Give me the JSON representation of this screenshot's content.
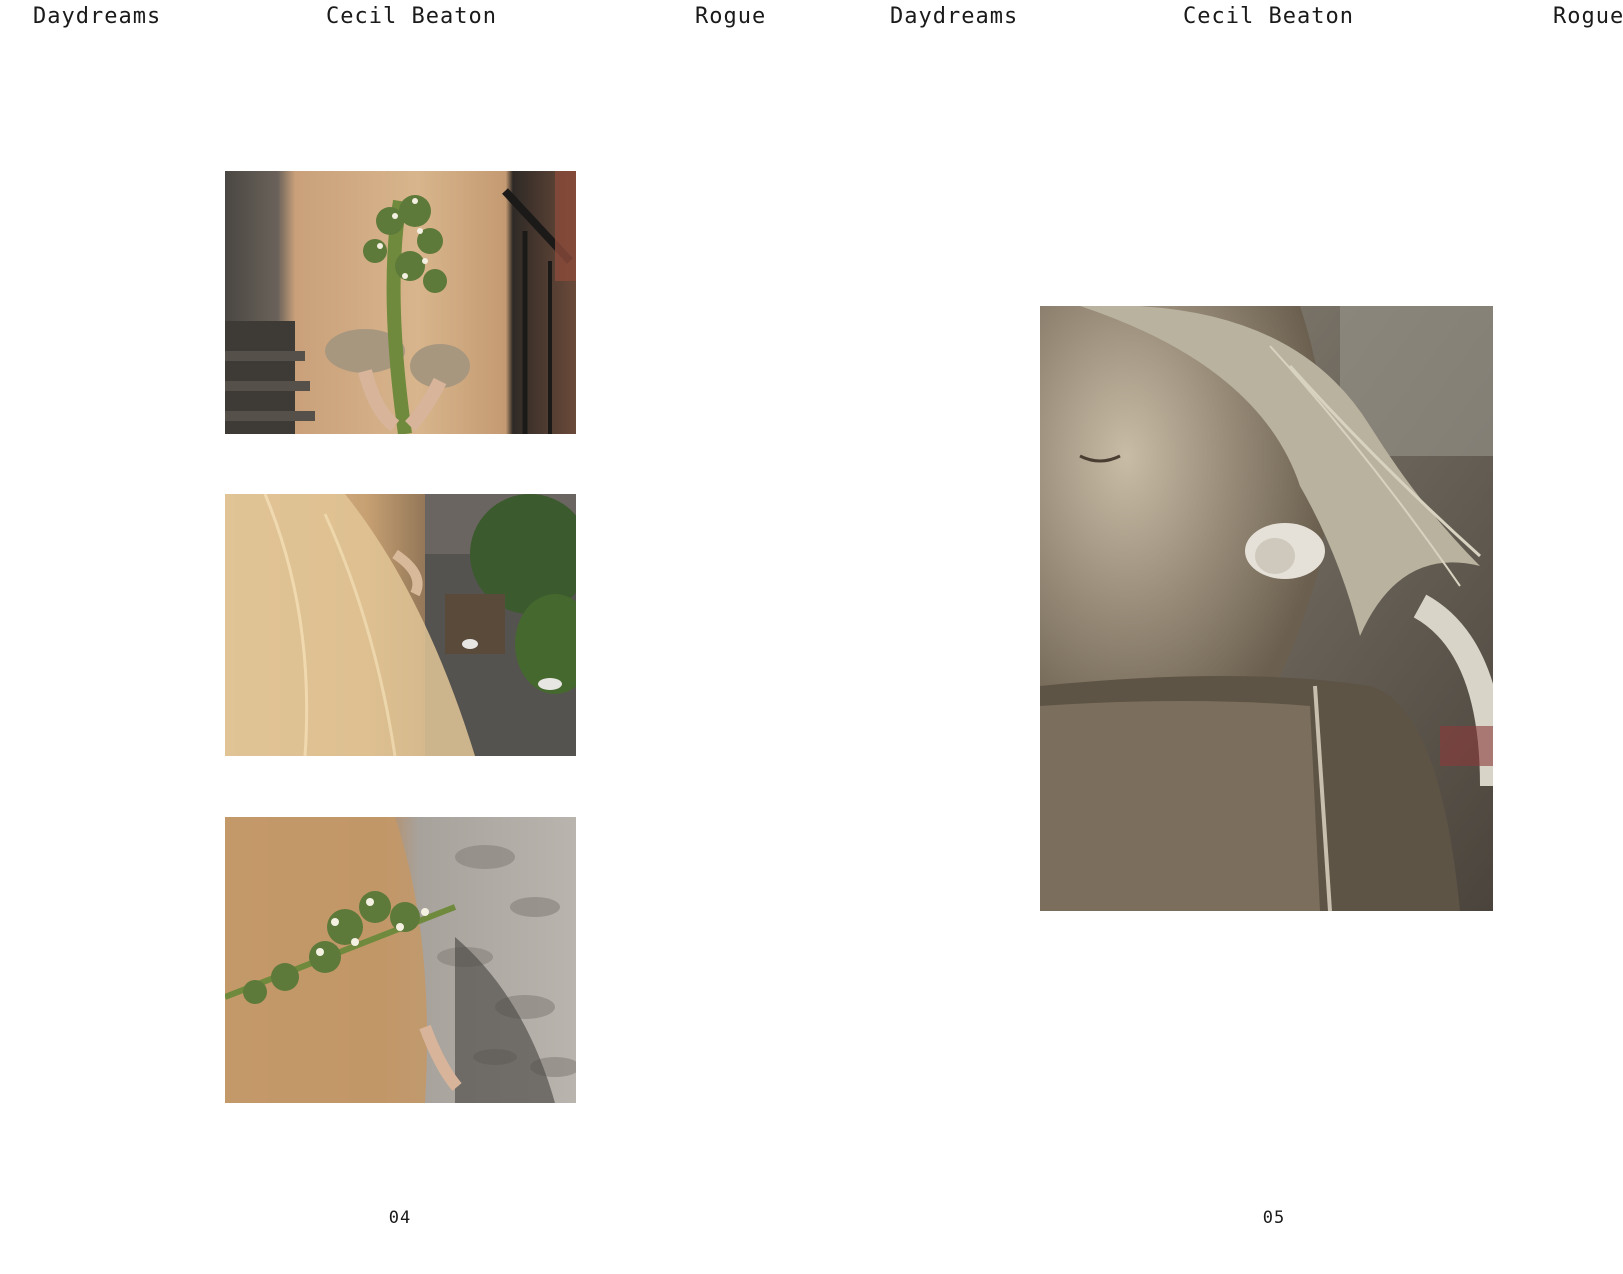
{
  "header": {
    "words": [
      "Daydreams",
      "Cecil Beaton",
      "Rogue",
      "Daydreams",
      "Cecil Beaton",
      "Rogue"
    ]
  },
  "spreads": [
    {
      "page_number": "04",
      "images": [
        {
          "subject": "hands-holding-daisy-bouquet-behind-back"
        },
        {
          "subject": "sheer-dress-in-garden-courtyard"
        },
        {
          "subject": "daisy-bouquet-against-stucco-wall"
        }
      ]
    },
    {
      "page_number": "05",
      "images": [
        {
          "subject": "portrait-woman-with-flower-earring"
        }
      ]
    }
  ],
  "colors": {
    "background": "#ffffff",
    "text": "#1a1a1a",
    "dress": "#c9a579",
    "foliage": "#5d7a3a",
    "portrait_tone": "#6e6454"
  }
}
